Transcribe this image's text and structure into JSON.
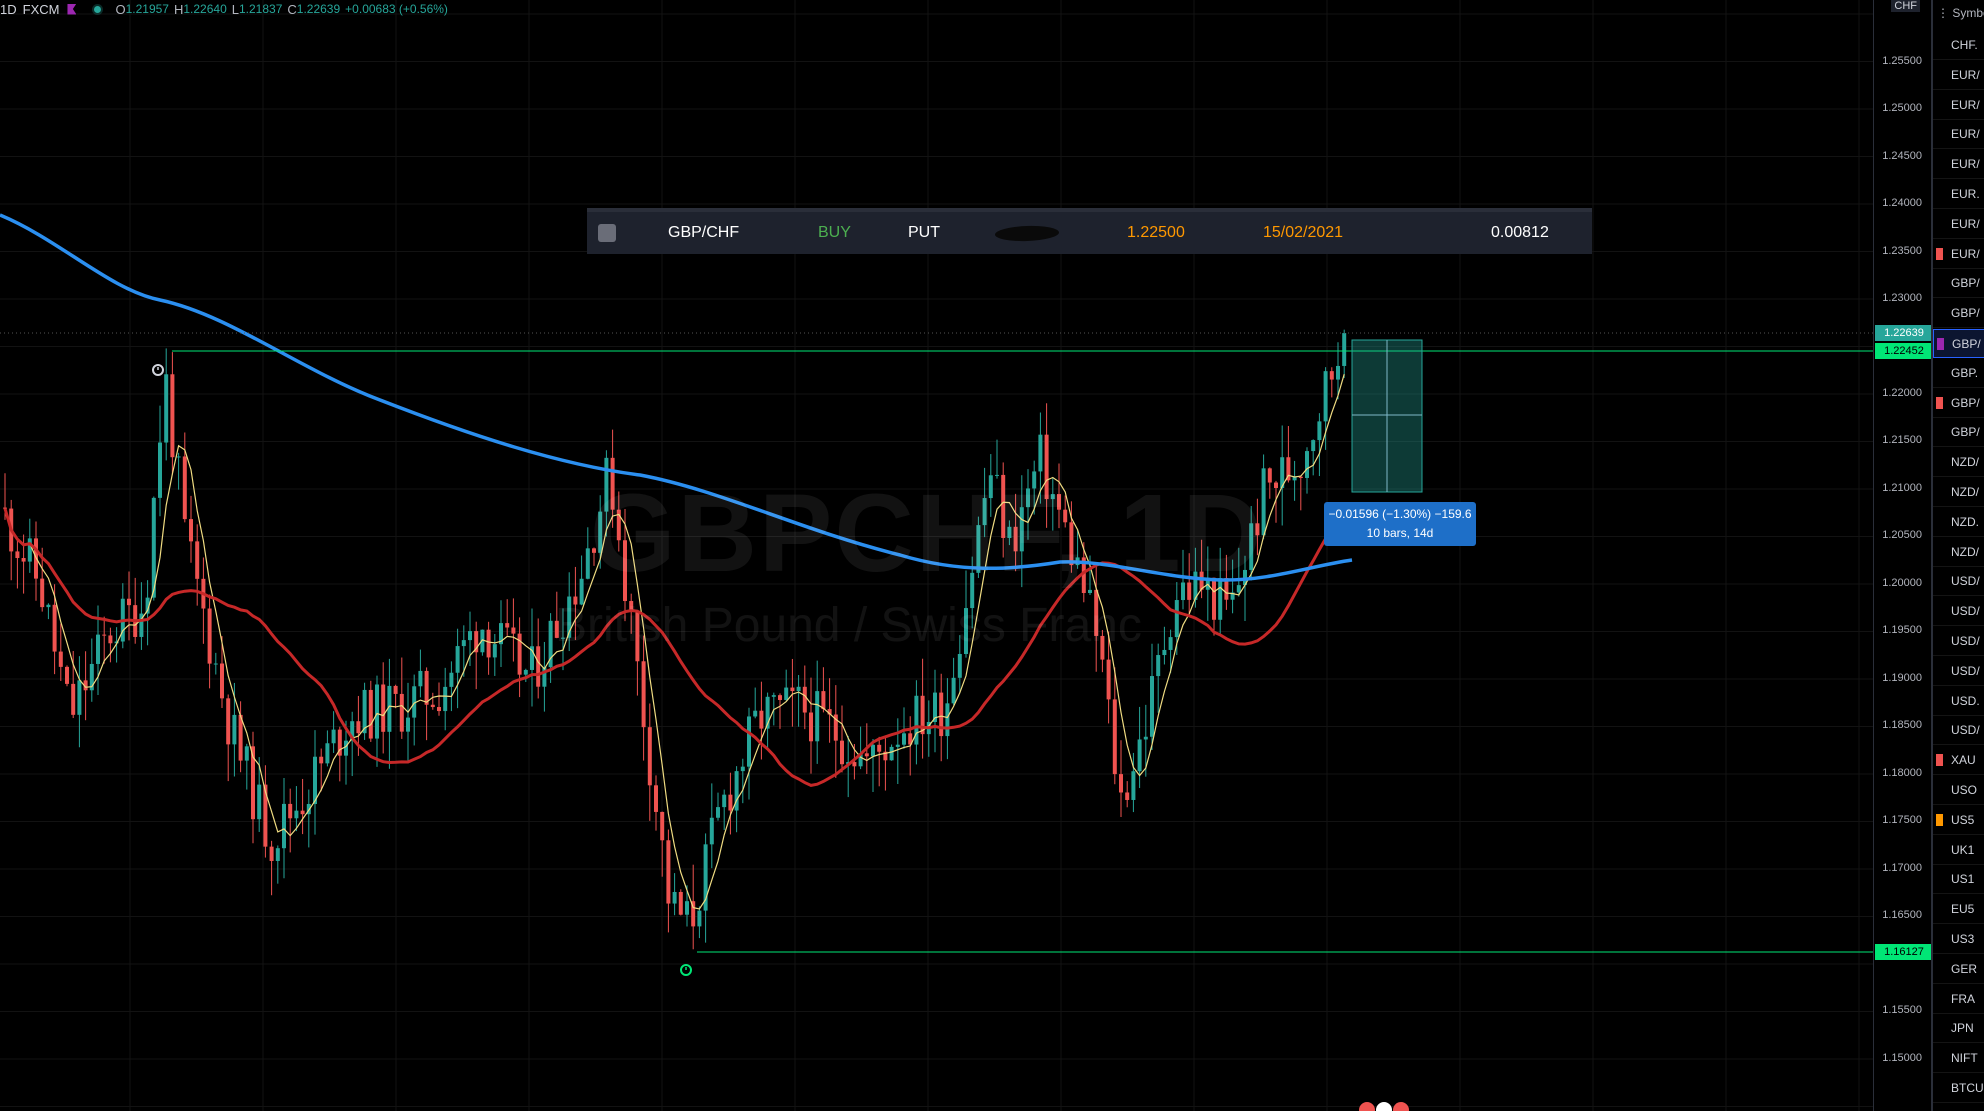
{
  "header": {
    "interval": "1D",
    "exchange": "FXCM",
    "open_label": "O",
    "open": "1.21957",
    "high_label": "H",
    "high": "1.22640",
    "low_label": "L",
    "low": "1.21837",
    "close_label": "C",
    "close": "1.22639",
    "change": "+0.00683 (+0.56%)"
  },
  "watermark": {
    "symbol": "GBPCHF, 1D",
    "description": "British Pound / Swiss Franc"
  },
  "order": {
    "symbol": "GBP/CHF",
    "side": "BUY",
    "type": "PUT",
    "strike": "1.22500",
    "expiry": "15/02/2021",
    "premium": "0.00812"
  },
  "measure": {
    "line1": "−0.01596 (−1.30%) −159.6",
    "line2": "10 bars, 14d"
  },
  "price_axis": {
    "currency": "CHF",
    "ticks": [
      "1.25500",
      "1.25000",
      "1.24500",
      "1.24000",
      "1.23500",
      "1.23000",
      "1.22000",
      "1.21500",
      "1.21000",
      "1.20500",
      "1.20000",
      "1.19500",
      "1.19000",
      "1.18500",
      "1.18000",
      "1.17500",
      "1.17000",
      "1.16500",
      "1.15500",
      "1.15000"
    ],
    "current_price": "1.22639",
    "level_high": "1.22452",
    "level_low": "1.16127"
  },
  "watchlist": {
    "header": "Symbol",
    "items": [
      "CHF.",
      "EUR/",
      "EUR/",
      "EUR/",
      "EUR/",
      "EUR.",
      "EUR/",
      "EUR/",
      "GBP/",
      "GBP/",
      "GBP/",
      "GBP.",
      "GBP/",
      "GBP/",
      "NZD/",
      "NZD/",
      "NZD.",
      "NZD/",
      "USD/",
      "USD/",
      "USD/",
      "USD/",
      "USD.",
      "USD/",
      "XAU",
      "USO",
      "US5",
      "UK1",
      "US1",
      "EU5",
      "US3",
      "GER",
      "FRA",
      "JPN",
      "NIFT",
      "BTCU"
    ]
  },
  "colors": {
    "up": "#26a69a",
    "down": "#ef5350",
    "ma_long": "#2b8ff0",
    "ma_mid": "#c62828",
    "ma_short": "#f0dc82",
    "level": "#00e676",
    "buy": "#4caf50",
    "accent": "#ff9800",
    "alert": "#00e676"
  }
}
